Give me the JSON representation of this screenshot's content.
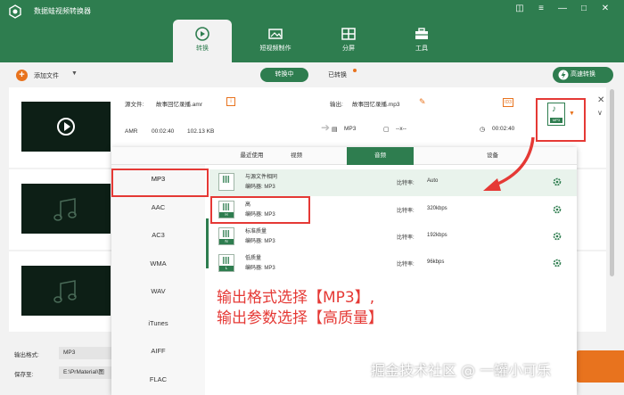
{
  "app": {
    "title": "数据蛙视频转换器"
  },
  "header_tabs": [
    {
      "label": "转换"
    },
    {
      "label": "短视频制作"
    },
    {
      "label": "分屏"
    },
    {
      "label": "工具"
    }
  ],
  "toolbar": {
    "add_file": "添加文件",
    "converting": "转换中",
    "converted": "已转换",
    "fast_convert": "高速转换"
  },
  "file": {
    "source_label": "源文件:",
    "source_name": "故事回忆录播.amr",
    "src_format": "AMR",
    "src_duration": "00:02:40",
    "src_size": "102.13 KB",
    "output_label": "输出:",
    "output_name": "故事回忆录播.mp3",
    "out_format": "MP3",
    "out_res": "--x--",
    "out_duration": "00:02:40",
    "id3": "ID3",
    "fmt_badge": "MP3"
  },
  "popup": {
    "tabs": [
      "最近使用",
      "视频",
      "音频",
      "设备"
    ],
    "formats": [
      "MP3",
      "AAC",
      "AC3",
      "WMA",
      "WAV",
      "iTunes",
      "AIFF",
      "FLAC"
    ],
    "presets": [
      {
        "name": "与源文件相同",
        "encoder": "编码器:  MP3",
        "bitrate": "比特率:",
        "bitrate_value": "Auto",
        "cap": ""
      },
      {
        "name": "高",
        "encoder": "编码器:  MP3",
        "bitrate": "比特率:",
        "bitrate_value": "320kbps",
        "cap": "H"
      },
      {
        "name": "标准质量",
        "encoder": "编码器:  MP3",
        "bitrate": "比特率:",
        "bitrate_value": "192kbps",
        "cap": "N"
      },
      {
        "name": "低质量",
        "encoder": "编码器:  MP3",
        "bitrate": "比特率:",
        "bitrate_value": "96kbps",
        "cap": "L"
      }
    ]
  },
  "bottom": {
    "output_format_label": "输出格式:",
    "output_format_value": "MP3",
    "save_to_label": "保存至:",
    "save_to_value": "E:\\PrMaterial\\图"
  },
  "annotation": {
    "line1": "输出格式选择【MP3】,",
    "line2": "输出参数选择【高质量】"
  },
  "watermark": "掘金技术社区 @ 一罐小可乐",
  "colors": {
    "brand": "#2e7d4f",
    "accent": "#e8731e",
    "highlight": "#e53935"
  }
}
